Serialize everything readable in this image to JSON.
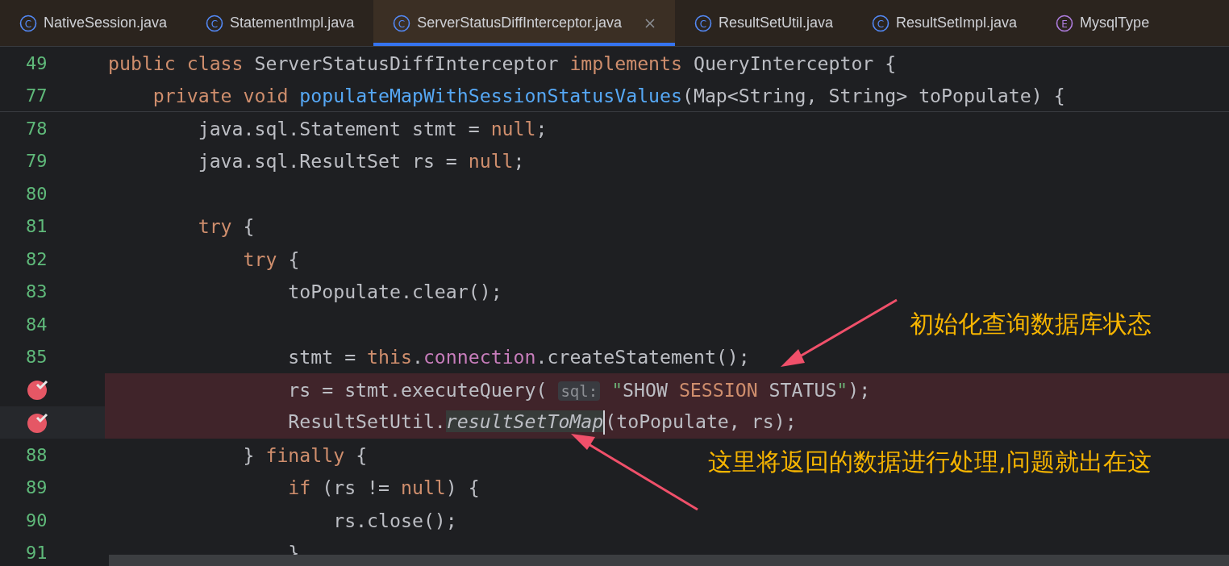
{
  "tabs": [
    {
      "icon": "C",
      "label": "NativeSession.java",
      "selected": false
    },
    {
      "icon": "C",
      "label": "StatementImpl.java",
      "selected": false
    },
    {
      "icon": "C",
      "label": "ServerStatusDiffInterceptor.java",
      "selected": true
    },
    {
      "icon": "C",
      "label": "ResultSetUtil.java",
      "selected": false
    },
    {
      "icon": "C",
      "label": "ResultSetImpl.java",
      "selected": false
    },
    {
      "icon": "E",
      "label": "MysqlType",
      "selected": false
    }
  ],
  "sticky_lines": [
    {
      "number": "49",
      "tokens": [
        {
          "kind": "keyword",
          "text": "public class "
        },
        {
          "kind": "plain",
          "text": "ServerStatusDiffInterceptor "
        },
        {
          "kind": "keyword",
          "text": "implements "
        },
        {
          "kind": "plain",
          "text": "QueryInterceptor {"
        }
      ]
    },
    {
      "number": "77",
      "tokens": [
        {
          "kind": "keyword",
          "text": "    private void "
        },
        {
          "kind": "method",
          "text": "populateMapWithSessionStatusValues"
        },
        {
          "kind": "plain",
          "text": "(Map<String, String> toPopulate) {"
        }
      ]
    }
  ],
  "lines": [
    {
      "number": "78",
      "breakpoint": false,
      "tokens": [
        {
          "kind": "plain",
          "text": "        java.sql.Statement stmt = "
        },
        {
          "kind": "keyword",
          "text": "null"
        },
        {
          "kind": "plain",
          "text": ";"
        }
      ]
    },
    {
      "number": "79",
      "breakpoint": false,
      "tokens": [
        {
          "kind": "plain",
          "text": "        java.sql.ResultSet rs = "
        },
        {
          "kind": "keyword",
          "text": "null"
        },
        {
          "kind": "plain",
          "text": ";"
        }
      ]
    },
    {
      "number": "80",
      "breakpoint": false
    },
    {
      "number": "81",
      "breakpoint": false,
      "tokens": [
        {
          "kind": "keyword",
          "text": "        try "
        },
        {
          "kind": "plain",
          "text": "{"
        }
      ]
    },
    {
      "number": "82",
      "breakpoint": false,
      "tokens": [
        {
          "kind": "keyword",
          "text": "            try "
        },
        {
          "kind": "plain",
          "text": "{"
        }
      ]
    },
    {
      "number": "83",
      "breakpoint": false,
      "tokens": [
        {
          "kind": "plain",
          "text": "                toPopulate.clear();"
        }
      ]
    },
    {
      "number": "84",
      "breakpoint": false
    },
    {
      "number": "85",
      "breakpoint": false,
      "tokens": [
        {
          "kind": "plain",
          "text": "                stmt = "
        },
        {
          "kind": "keyword",
          "text": "this"
        },
        {
          "kind": "plain",
          "text": "."
        },
        {
          "kind": "field",
          "text": "connection"
        },
        {
          "kind": "plain",
          "text": ".createStatement();"
        }
      ]
    },
    {
      "breakpoint": true,
      "tokens": [
        {
          "kind": "plain",
          "text": "                rs = stmt.executeQuery( "
        },
        {
          "kind": "hint",
          "text": "sql:"
        },
        {
          "kind": "string",
          "text": " \""
        },
        {
          "kind": "plain",
          "text": "SHOW "
        },
        {
          "kind": "keyword",
          "text": "SESSION "
        },
        {
          "kind": "plain",
          "text": "STATUS"
        },
        {
          "kind": "string",
          "text": "\""
        },
        {
          "kind": "plain",
          "text": ");"
        }
      ]
    },
    {
      "breakpoint": true,
      "tokens": [
        {
          "kind": "plain",
          "text": "                ResultSetUtil."
        },
        {
          "kind": "italic",
          "text": "resultSetToMap"
        },
        {
          "kind": "caret"
        },
        {
          "kind": "plain",
          "text": "(toPopulate, rs);"
        }
      ]
    },
    {
      "number": "88",
      "breakpoint": false,
      "tokens": [
        {
          "kind": "plain",
          "text": "            } "
        },
        {
          "kind": "keyword",
          "text": "finally "
        },
        {
          "kind": "plain",
          "text": "{"
        }
      ]
    },
    {
      "number": "89",
      "breakpoint": false,
      "tokens": [
        {
          "kind": "keyword",
          "text": "                if "
        },
        {
          "kind": "plain",
          "text": "(rs != "
        },
        {
          "kind": "keyword",
          "text": "null"
        },
        {
          "kind": "plain",
          "text": ") {"
        }
      ]
    },
    {
      "number": "90",
      "breakpoint": false,
      "tokens": [
        {
          "kind": "plain",
          "text": "                    rs.close();"
        }
      ]
    },
    {
      "number": "91",
      "breakpoint": false,
      "tokens": [
        {
          "kind": "plain",
          "text": "                }"
        }
      ]
    }
  ],
  "annotations": [
    {
      "text": "初始化查询数据库状态"
    },
    {
      "text": "这里将返回的数据进行处理,问题就出在这"
    }
  ]
}
